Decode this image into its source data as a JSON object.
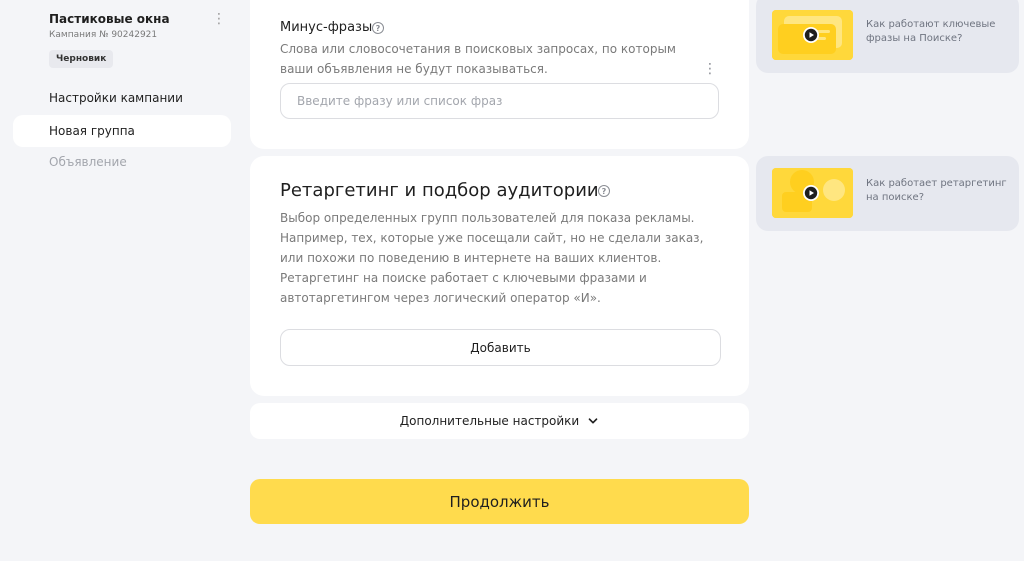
{
  "sidebar": {
    "campaign_title": "Пастиковые окна",
    "campaign_number": "Кампания № 90242921",
    "status_badge": "Черновик",
    "items": [
      {
        "label": "Настройки кампании",
        "active": false
      },
      {
        "label": "Новая группа",
        "active": true
      },
      {
        "label": "Объявление",
        "active": false,
        "disabled": true
      }
    ]
  },
  "minus_phrases": {
    "label": "Минус-фразы",
    "description": "Слова или словосочетания в поисковых запросах, по которым ваши объявления не будут показываться.",
    "input_placeholder": "Введите фразу или список фраз",
    "input_value": ""
  },
  "retargeting": {
    "title": "Ретаргетинг и подбор аудитории",
    "description": "Выбор определенных групп пользователей для показа рекламы. Например, тех, которые уже посещали сайт, но не сделали заказ, или похожи по поведению в интернете на ваших клиентов. Ретаргетинг на поиске работает с ключевыми фразами и автотаргетингом через логический оператор «И».",
    "add_button": "Добавить"
  },
  "additional_settings": {
    "label": "Дополнительные настройки"
  },
  "continue_button": "Продолжить",
  "help_videos": [
    {
      "label": "Как работают ключевые фразы на Поиске?"
    },
    {
      "label": "Как работает ретаргетинг на поиске?"
    }
  ],
  "colors": {
    "background": "#f4f5f8",
    "card": "#ffffff",
    "accent_yellow": "#ffdb4d",
    "muted_text": "#7a7a7a",
    "help_card": "#e6e8ef"
  },
  "icons": {
    "help": "help-circle-icon",
    "kebab": "kebab-menu-icon",
    "chevron": "chevron-down-icon",
    "play": "play-icon"
  }
}
